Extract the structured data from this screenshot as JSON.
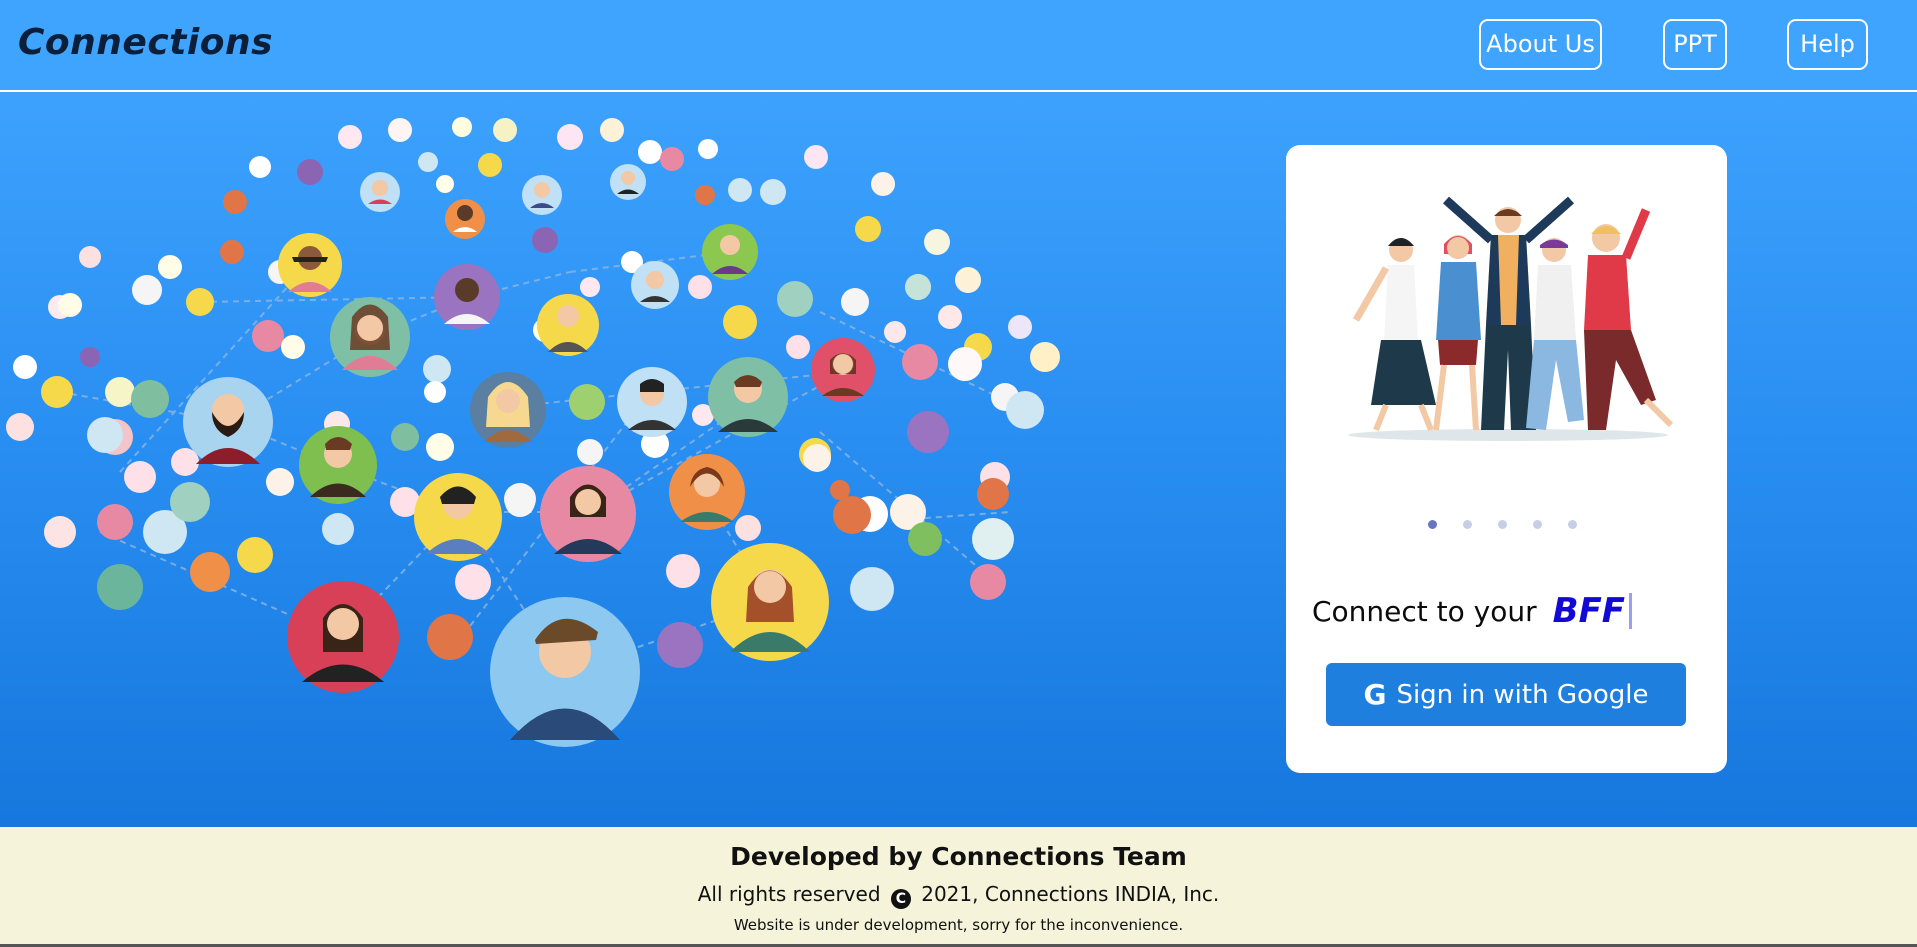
{
  "navbar": {
    "brand": "Connections",
    "buttons": [
      {
        "label": "About Us"
      },
      {
        "label": "PPT"
      },
      {
        "label": "Help"
      }
    ]
  },
  "hero": {
    "illustration": "people-network-illustration",
    "card": {
      "illustration": "friends-group-illustration",
      "carousel": {
        "count": 5,
        "active_index": 0
      },
      "tagline": "Connect to your",
      "highlight_word": "BFF",
      "signin_icon": "google-g-icon",
      "signin_label": "Sign in with Google"
    }
  },
  "footer": {
    "heading": "Developed by Connections Team",
    "rights_prefix": "All rights reserved",
    "copyright_symbol": "C",
    "rights_suffix": "2021, Connections INDIA, Inc.",
    "notice": "Website is under development, sorry for the inconvenience."
  },
  "colors": {
    "navbar_bg": "#3ea4fd",
    "hero_top": "#3da2fd",
    "hero_bottom": "#1677dd",
    "button_blue": "#1f7fde",
    "bff_color": "#1209d7",
    "footer_bg": "#f5f4da"
  }
}
